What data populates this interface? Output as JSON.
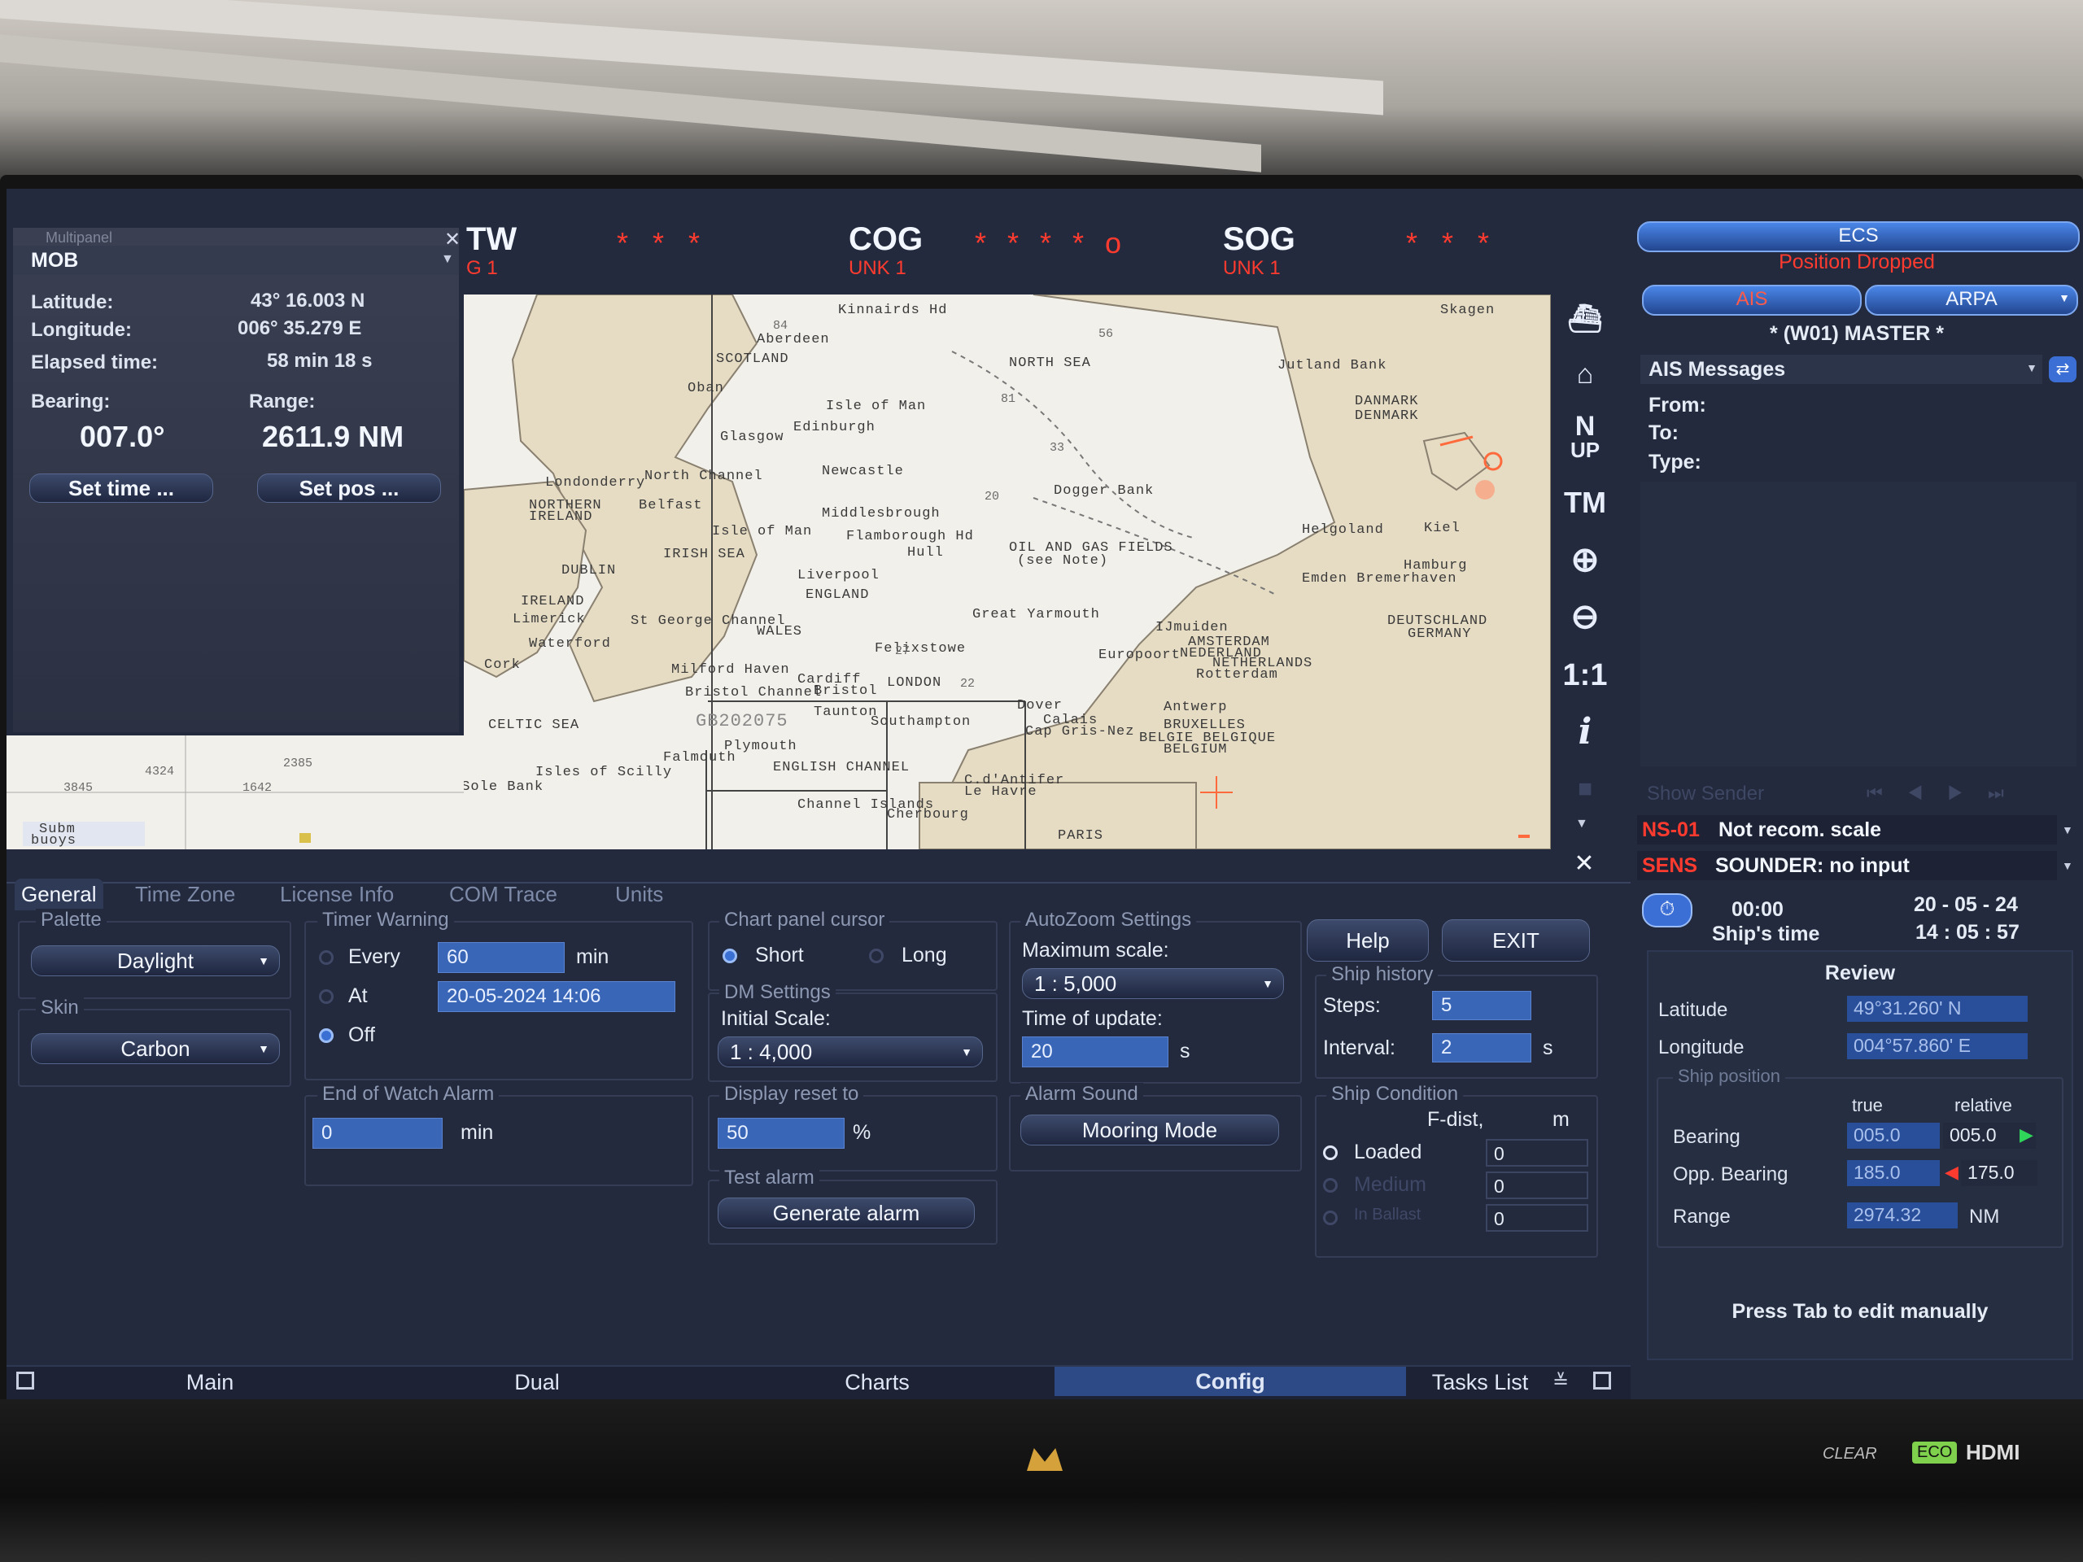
{
  "top_bar": {
    "stw_label": "TW",
    "stw_sub": "G 1",
    "cog_label": "COG",
    "cog_sub": "UNK 1",
    "sog_label": "SOG",
    "sog_sub": "UNK 1",
    "stars1": "* * *",
    "stars2": "* * *  * o",
    "stars3": "* *  *"
  },
  "mob_panel": {
    "header": "Multipanel",
    "title": "MOB",
    "latitude_label": "Latitude:",
    "latitude_value": "43° 16.003 N",
    "longitude_label": "Longitude:",
    "longitude_value": "006° 35.279 E",
    "elapsed_label": "Elapsed time:",
    "elapsed_value": "58 min 18 s",
    "bearing_label": "Bearing:",
    "bearing_value": "007.0°",
    "range_label": "Range:",
    "range_value": "2611.9 NM",
    "set_time_label": "Set time ...",
    "set_pos_label": "Set pos ..."
  },
  "map": {
    "labels": {
      "aberdeen": "Aberdeen",
      "kinnairds": "Kinnairds Hd",
      "scotland": "SCOTLAND",
      "north_sea": "NORTH SEA",
      "jutland_bank": "Jutland Bank",
      "skagen": "Skagen",
      "danmark": "DANMARK",
      "denmark": "DENMARK",
      "oban": "Oban",
      "isle_of_man_top": "Isle of Man",
      "edinburgh": "Edinburgh",
      "glasgow": "Glasgow",
      "newcastle": "Newcastle",
      "north_channel": "North Channel",
      "londonderry": "Londonderry",
      "northern_ireland": "NORTHERN",
      "ireland_n": "IRELAND",
      "belfast": "Belfast",
      "middlesbrough": "Middlesbrough",
      "dogger_bank": "Dogger Bank",
      "isle_of_man": "Isle of Man",
      "flamborough": "Flamborough Hd",
      "oil_gas": "OIL AND GAS FIELDS",
      "see_note": "(see Note)",
      "hull": "Hull",
      "irish_sea": "IRISH SEA",
      "heligoland": "Helgoland",
      "kiel": "Kiel",
      "hamburg": "Hamburg",
      "emden": "Emden Bremerhaven",
      "dublin": "DUBLIN",
      "liverpool": "Liverpool",
      "england": "ENGLAND",
      "ireland": "IRELAND",
      "limerick": "Limerick",
      "st_george": "St George Channel",
      "wales": "WALES",
      "great_yarmouth": "Great Yarmouth",
      "ijmuiden": "IJmuiden",
      "amsterdam": "AMSTERDAM",
      "nederland": "NEDERLAND",
      "netherlands": "NETHERLANDS",
      "deutschland": "DEUTSCHLAND",
      "germany": "GERMANY",
      "waterford": "Waterford",
      "felixstowe": "Felixstowe",
      "europoort": "Europoort",
      "rotterdam": "Rotterdam",
      "cork": "Cork",
      "milford_haven": "Milford Haven",
      "cardiff": "Cardiff",
      "london": "LONDON",
      "bristol_channel": "Bristol Channel",
      "bristol": "Bristol",
      "antwerp": "Antwerp",
      "celtic_sea": "CELTIC SEA",
      "taunton": "Taunton",
      "southampton": "Southampton",
      "dover": "Dover",
      "calais": "Calais",
      "cap_gris_nez": "Cap Gris-Nez",
      "bruxelles": "BRUXELLES",
      "belgie": "BELGIE BELGIQUE",
      "belgium": "BELGIUM",
      "plymouth": "Plymouth",
      "english_channel": "ENGLISH CHANNEL",
      "isles_scilly": "Isles of Scilly",
      "falmouth": "Falmouth",
      "great_sole_bank": "Great Sole Bank",
      "cd_antifer": "C.d'Antifer",
      "le_havre": "Le Havre",
      "channel_islands": "Channel Islands",
      "cherbourg": "Cherbourg",
      "paris": "PARIS",
      "chart_id": "GB202075",
      "buoys": "buoys",
      "subm": "Subm"
    }
  },
  "right_toolbar": {
    "n_up": "N",
    "n_up2": "UP",
    "tm": "TM",
    "one_to_one": "1:1",
    "info": "i",
    "close": "✕"
  },
  "tabs": [
    "General",
    "Time Zone",
    "License Info",
    "COM Trace",
    "Units"
  ],
  "general": {
    "palette_title": "Palette",
    "palette_value": "Daylight",
    "skin_title": "Skin",
    "skin_value": "Carbon",
    "timer_title": "Timer Warning",
    "every_label": "Every",
    "every_value": "60",
    "every_unit": "min",
    "at_label": "At",
    "at_value": "20-05-2024 14:06",
    "off_label": "Off",
    "eow_title": "End of Watch Alarm",
    "eow_value": "0",
    "eow_unit": "min",
    "cursor_title": "Chart panel cursor",
    "short_label": "Short",
    "long_label": "Long",
    "dm_title": "DM Settings",
    "initial_scale_label": "Initial Scale:",
    "initial_scale_value": "1 : 4,000",
    "display_reset_title": "Display reset to",
    "display_reset_value": "50",
    "display_reset_unit": "%",
    "test_alarm_title": "Test alarm",
    "generate_alarm": "Generate alarm",
    "autozoom_title": "AutoZoom Settings",
    "max_scale_label": "Maximum scale:",
    "max_scale_value": "1 : 5,000",
    "time_update_label": "Time of update:",
    "time_update_value": "20",
    "time_update_unit": "s",
    "alarm_sound_title": "Alarm Sound",
    "mooring_mode": "Mooring Mode",
    "help": "Help",
    "exit": "EXIT",
    "ship_history_title": "Ship history",
    "steps_label": "Steps:",
    "steps_value": "5",
    "interval_label": "Interval:",
    "interval_value": "2",
    "interval_unit": "s",
    "ship_condition_title": "Ship Condition",
    "fdist_label": "F-dist,",
    "fdist_unit": "m",
    "loaded_label": "Loaded",
    "loaded_value": "0",
    "medium_label": "Medium",
    "medium_value": "0",
    "inballast_label": "In Ballast",
    "inballast_value": "0"
  },
  "bottom_nav": {
    "main": "Main",
    "dual": "Dual",
    "charts": "Charts",
    "config": "Config",
    "tasks_list": "Tasks List"
  },
  "right_panel": {
    "ecs": "ECS",
    "position_dropped": "Position Dropped",
    "ais": "AIS",
    "arpa": "ARPA",
    "master": "* (W01) MASTER *",
    "ais_messages": "AIS Messages",
    "from_label": "From:",
    "to_label": "To:",
    "type_label": "Type:",
    "show_sender": "Show Sender",
    "alert1_code": "NS-01",
    "alert1_text": "Not recom. scale",
    "alert2_code": "SENS",
    "alert2_text": "SOUNDER: no input",
    "timer": "00:00",
    "date": "20 - 05 - 24",
    "ships_time_label": "Ship's time",
    "ships_time": "14 : 05 : 57",
    "review_title": "Review",
    "latitude_label": "Latitude",
    "latitude_value": "49°31.260' N",
    "longitude_label": "Longitude",
    "longitude_value": "004°57.860' E",
    "ship_position_title": "Ship position",
    "true_label": "true",
    "relative_label": "relative",
    "bearing_label": "Bearing",
    "bearing_true": "005.0",
    "bearing_rel": "005.0",
    "opp_bearing_label": "Opp. Bearing",
    "opp_bearing_true": "185.0",
    "opp_bearing_rel": "175.0",
    "range_label": "Range",
    "range_value": "2974.32",
    "range_unit": "NM",
    "press_tab": "Press Tab to edit manually"
  },
  "colors": {
    "screen_bg": "#232a3d",
    "field_blue": "#3a66b8",
    "alert_red": "#ff3b30",
    "accent_blue": "#3c6fd6",
    "map_bg": "#f2f0ea"
  },
  "monitor": {
    "hdmi": "HDMI",
    "eco": "ECO",
    "clear": "CLEAR"
  }
}
